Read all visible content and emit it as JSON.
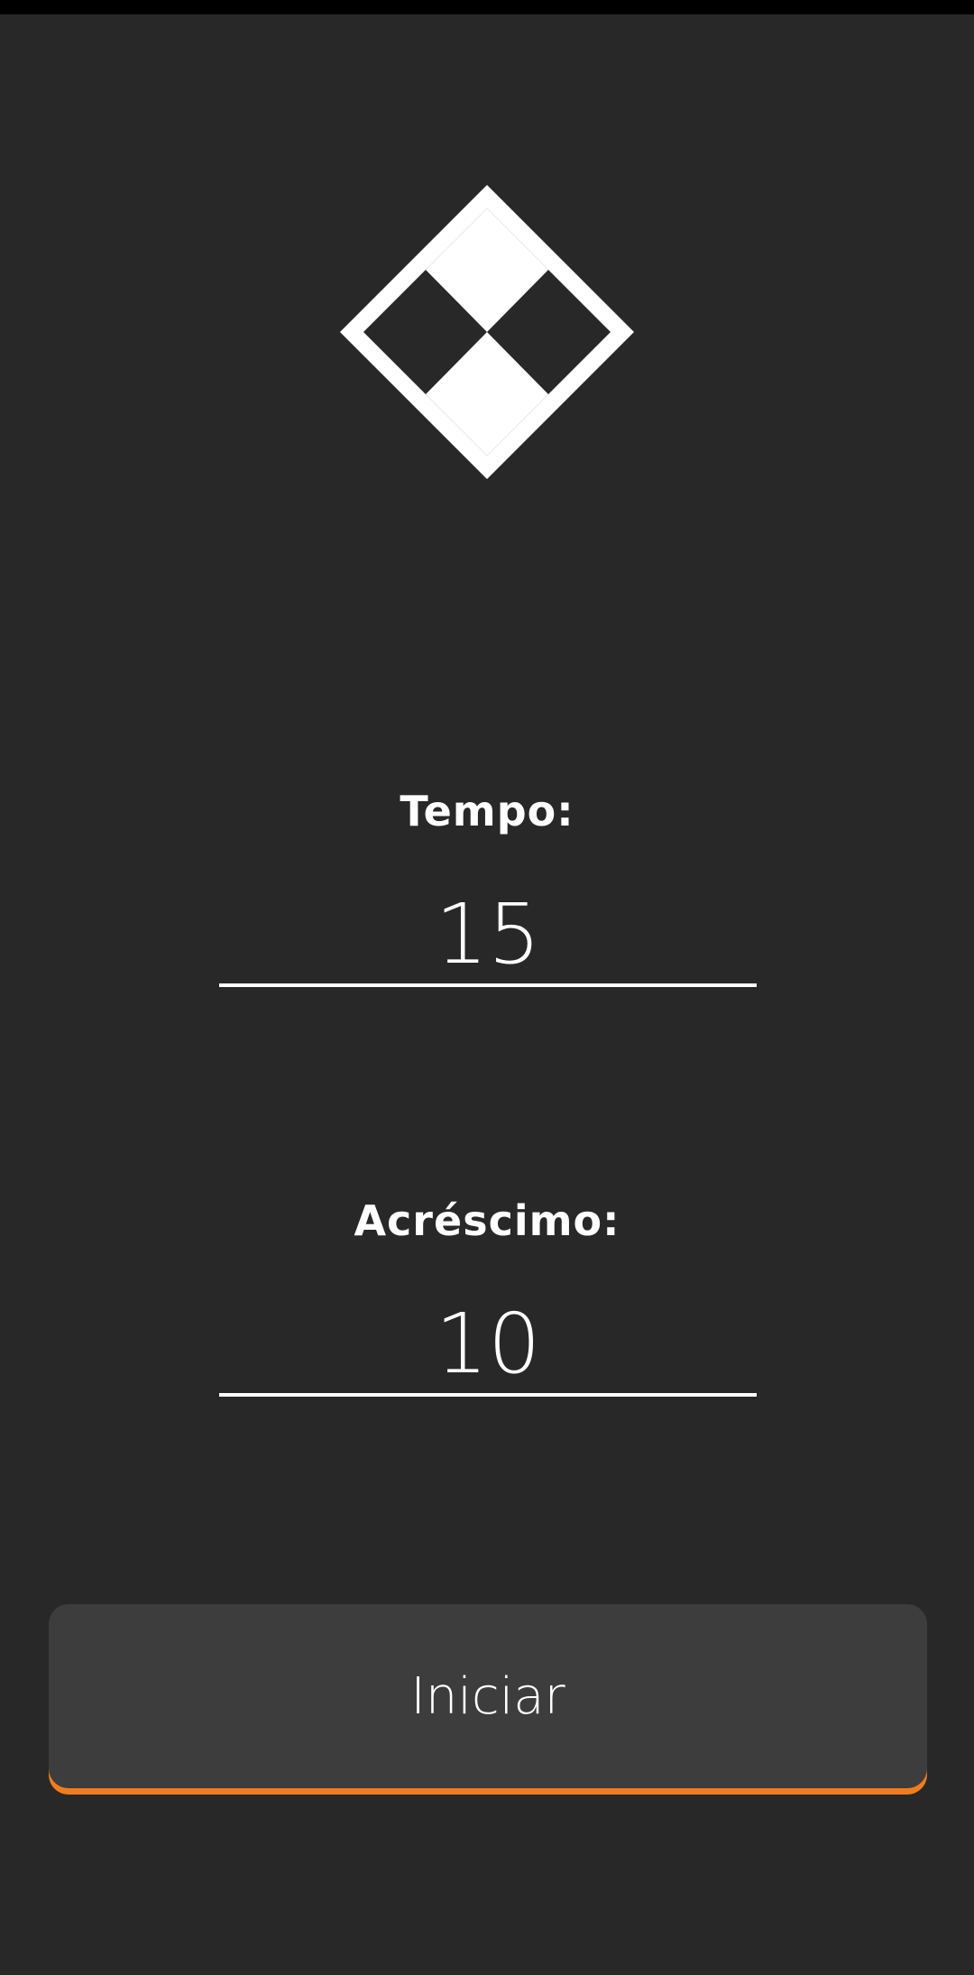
{
  "app": {
    "logo_icon": "checkered-diamond-icon"
  },
  "form": {
    "time_label": "Tempo:",
    "time_value": "15",
    "increment_label": "Acréscimo:",
    "increment_value": "10"
  },
  "actions": {
    "start_label": "Iniciar"
  },
  "colors": {
    "background": "#282828",
    "status_bar": "#000000",
    "button": "#3d3d3d",
    "accent": "#f07d1d",
    "foreground": "#ffffff"
  }
}
